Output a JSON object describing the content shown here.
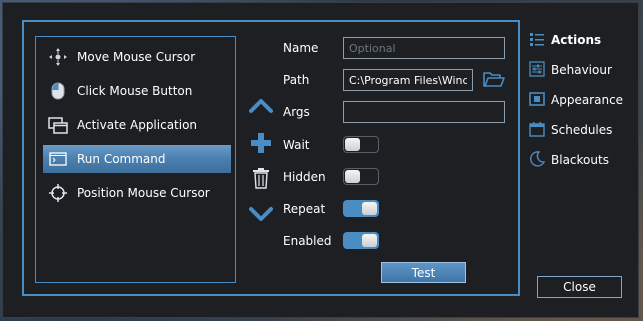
{
  "actions": {
    "items": [
      {
        "label": "Move Mouse Cursor",
        "icon": "move-cursor-icon"
      },
      {
        "label": "Click Mouse Button",
        "icon": "mouse-icon"
      },
      {
        "label": "Activate Application",
        "icon": "windows-icon"
      },
      {
        "label": "Run Command",
        "icon": "terminal-icon",
        "selected": true
      },
      {
        "label": "Position Mouse Cursor",
        "icon": "crosshair-icon"
      }
    ]
  },
  "form": {
    "name_label": "Name",
    "name_value": "",
    "name_placeholder": "Optional",
    "path_label": "Path",
    "path_value": "C:\\Program Files\\Windo",
    "args_label": "Args",
    "args_value": "",
    "wait_label": "Wait",
    "wait_on": false,
    "hidden_label": "Hidden",
    "hidden_on": false,
    "repeat_label": "Repeat",
    "repeat_on": true,
    "enabled_label": "Enabled",
    "enabled_on": true,
    "test_label": "Test"
  },
  "nav": {
    "items": [
      {
        "label": "Actions",
        "icon": "list-icon",
        "active": true
      },
      {
        "label": "Behaviour",
        "icon": "sliders-icon"
      },
      {
        "label": "Appearance",
        "icon": "monitor-icon"
      },
      {
        "label": "Schedules",
        "icon": "calendar-icon"
      },
      {
        "label": "Blackouts",
        "icon": "moon-icon"
      }
    ]
  },
  "close_label": "Close",
  "colors": {
    "accent": "#4a8cc4",
    "background": "#1d1f22",
    "selected": "#4a7fae"
  }
}
